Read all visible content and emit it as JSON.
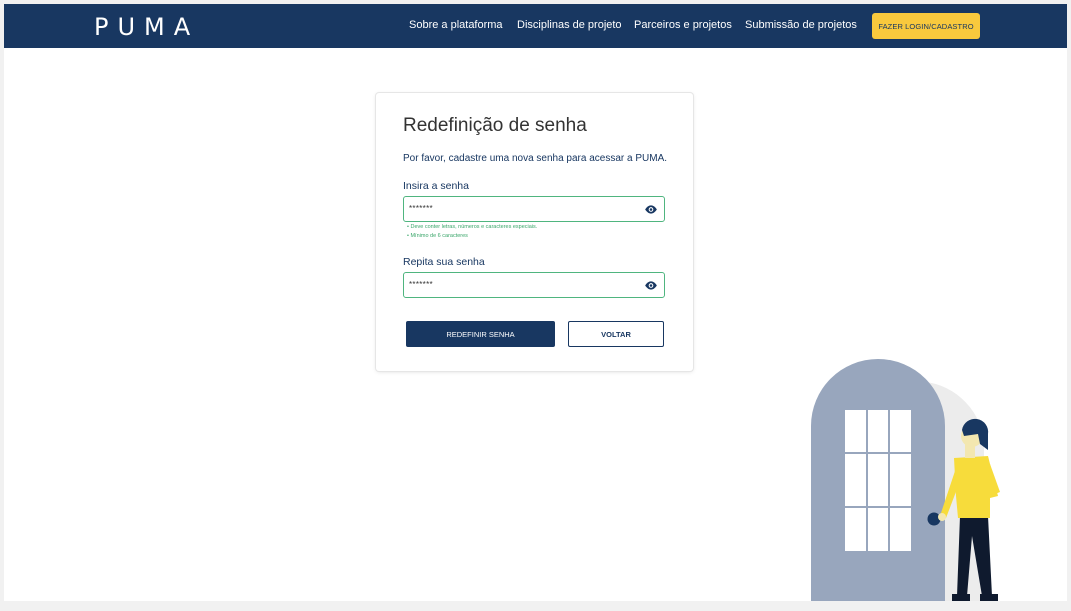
{
  "header": {
    "logo": "PUMA",
    "nav": {
      "about": "Sobre a plataforma",
      "disciplines": "Disciplinas de projeto",
      "partners": "Parceiros e projetos",
      "submission": "Submissão de projetos"
    },
    "login_button": "FAZER LOGIN/CADASTRO"
  },
  "card": {
    "title": "Redefinição de senha",
    "subtitle": "Por favor, cadastre uma nova senha para acessar a PUMA.",
    "password": {
      "label": "Insira a senha",
      "value": "*******",
      "toggle_icon": "eye-icon",
      "hints": [
        "Deve conter letras, números e caracteres especiais.",
        "Mínimo de 6 caracteres"
      ]
    },
    "confirm": {
      "label": "Repita sua senha",
      "value": "*******",
      "toggle_icon": "eye-icon"
    },
    "submit_label": "REDEFINIR SENHA",
    "back_label": "VOLTAR"
  },
  "colors": {
    "primary": "#183761",
    "accent": "#f9c93d",
    "valid_border": "#4fb57f",
    "hint_text": "#3aa66a"
  }
}
